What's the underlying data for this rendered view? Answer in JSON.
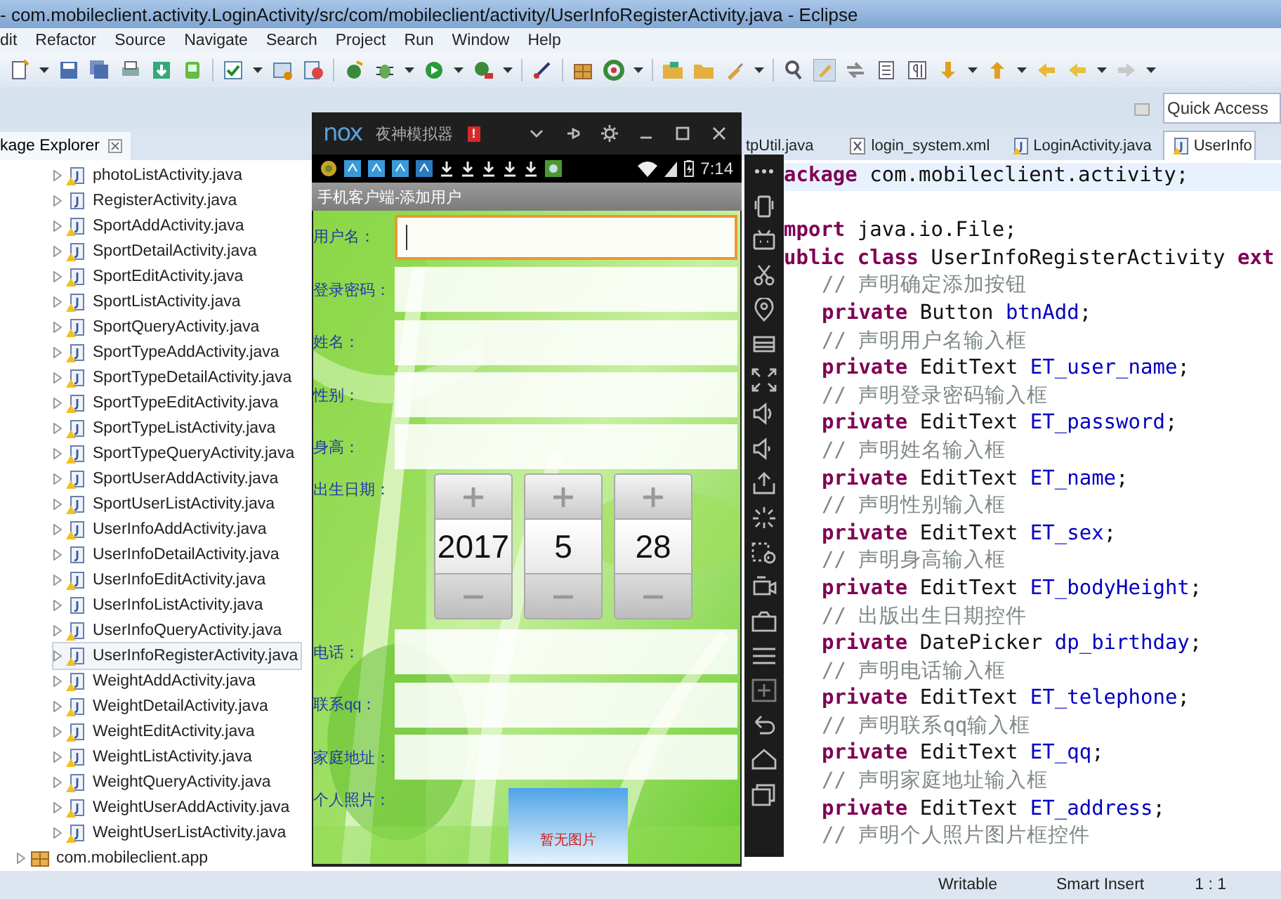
{
  "window": {
    "title": "- com.mobileclient.activity.LoginActivity/src/com/mobileclient/activity/UserInfoRegisterActivity.java - Eclipse"
  },
  "menu": [
    "dit",
    "Refactor",
    "Source",
    "Navigate",
    "Search",
    "Project",
    "Run",
    "Window",
    "Help"
  ],
  "quick_access": {
    "placeholder": "Quick Access"
  },
  "explorer": {
    "title": "kage Explorer",
    "items": [
      {
        "label": "photoListActivity.java",
        "kind": "file",
        "warning": true,
        "selected": false
      },
      {
        "label": "RegisterActivity.java",
        "kind": "file",
        "warning": false,
        "selected": false
      },
      {
        "label": "SportAddActivity.java",
        "kind": "file",
        "warning": true,
        "selected": false
      },
      {
        "label": "SportDetailActivity.java",
        "kind": "file",
        "warning": true,
        "selected": false
      },
      {
        "label": "SportEditActivity.java",
        "kind": "file",
        "warning": true,
        "selected": false
      },
      {
        "label": "SportListActivity.java",
        "kind": "file",
        "warning": true,
        "selected": false
      },
      {
        "label": "SportQueryActivity.java",
        "kind": "file",
        "warning": true,
        "selected": false
      },
      {
        "label": "SportTypeAddActivity.java",
        "kind": "file",
        "warning": true,
        "selected": false
      },
      {
        "label": "SportTypeDetailActivity.java",
        "kind": "file",
        "warning": true,
        "selected": false
      },
      {
        "label": "SportTypeEditActivity.java",
        "kind": "file",
        "warning": true,
        "selected": false
      },
      {
        "label": "SportTypeListActivity.java",
        "kind": "file",
        "warning": true,
        "selected": false
      },
      {
        "label": "SportTypeQueryActivity.java",
        "kind": "file",
        "warning": true,
        "selected": false
      },
      {
        "label": "SportUserAddActivity.java",
        "kind": "file",
        "warning": true,
        "selected": false
      },
      {
        "label": "SportUserListActivity.java",
        "kind": "file",
        "warning": true,
        "selected": false
      },
      {
        "label": "UserInfoAddActivity.java",
        "kind": "file",
        "warning": true,
        "selected": false
      },
      {
        "label": "UserInfoDetailActivity.java",
        "kind": "file",
        "warning": false,
        "selected": false
      },
      {
        "label": "UserInfoEditActivity.java",
        "kind": "file",
        "warning": true,
        "selected": false
      },
      {
        "label": "UserInfoListActivity.java",
        "kind": "file",
        "warning": false,
        "selected": false
      },
      {
        "label": "UserInfoQueryActivity.java",
        "kind": "file",
        "warning": true,
        "selected": false
      },
      {
        "label": "UserInfoRegisterActivity.java",
        "kind": "file",
        "warning": true,
        "selected": true
      },
      {
        "label": "WeightAddActivity.java",
        "kind": "file",
        "warning": true,
        "selected": false
      },
      {
        "label": "WeightDetailActivity.java",
        "kind": "file",
        "warning": true,
        "selected": false
      },
      {
        "label": "WeightEditActivity.java",
        "kind": "file",
        "warning": true,
        "selected": false
      },
      {
        "label": "WeightListActivity.java",
        "kind": "file",
        "warning": true,
        "selected": false
      },
      {
        "label": "WeightQueryActivity.java",
        "kind": "file",
        "warning": true,
        "selected": false
      },
      {
        "label": "WeightUserAddActivity.java",
        "kind": "file",
        "warning": true,
        "selected": false
      },
      {
        "label": "WeightUserListActivity.java",
        "kind": "file",
        "warning": true,
        "selected": false
      },
      {
        "label": "com.mobileclient.app",
        "kind": "package",
        "warning": false,
        "selected": false
      }
    ]
  },
  "editor": {
    "tabs": [
      {
        "label": "tpUtil.java",
        "selected": false
      },
      {
        "label": "login_system.xml",
        "kind": "xml",
        "selected": false
      },
      {
        "label": "LoginActivity.java",
        "kind": "java",
        "selected": false
      },
      {
        "label": "UserInfo",
        "kind": "java",
        "selected": true
      }
    ],
    "lines": [
      {
        "kind": "top",
        "current": true,
        "tokens": [
          {
            "kind": "keyword",
            "text": "ackage"
          },
          {
            "kind": "plain",
            "text": " com.mobileclient.activity;"
          }
        ]
      },
      {
        "kind": "blank"
      },
      {
        "kind": "top",
        "current": false,
        "tokens": [
          {
            "kind": "keyword",
            "text": "mport"
          },
          {
            "kind": "plain",
            "text": " java.io.File;"
          }
        ]
      },
      {
        "kind": "top",
        "current": false,
        "tokens": [
          {
            "kind": "keyword",
            "text": "ublic class"
          },
          {
            "kind": "plain",
            "text": " UserInfoRegisterActivity "
          },
          {
            "kind": "keyword",
            "text": "ext"
          }
        ]
      },
      {
        "kind": "member",
        "current": false,
        "tokens": [
          {
            "kind": "comment",
            "text": "// 声明确定添加按钮"
          }
        ]
      },
      {
        "kind": "member",
        "current": false,
        "tokens": [
          {
            "kind": "keyword",
            "text": "private"
          },
          {
            "kind": "plain",
            "text": " Button "
          },
          {
            "kind": "field",
            "text": "btnAdd"
          },
          {
            "kind": "plain",
            "text": ";"
          }
        ]
      },
      {
        "kind": "member",
        "current": false,
        "tokens": [
          {
            "kind": "comment",
            "text": "// 声明用户名输入框"
          }
        ]
      },
      {
        "kind": "member",
        "current": false,
        "tokens": [
          {
            "kind": "keyword",
            "text": "private"
          },
          {
            "kind": "plain",
            "text": " EditText "
          },
          {
            "kind": "field",
            "text": "ET_user_name"
          },
          {
            "kind": "plain",
            "text": ";"
          }
        ]
      },
      {
        "kind": "member",
        "current": false,
        "tokens": [
          {
            "kind": "comment",
            "text": "// 声明登录密码输入框"
          }
        ]
      },
      {
        "kind": "member",
        "current": false,
        "tokens": [
          {
            "kind": "keyword",
            "text": "private"
          },
          {
            "kind": "plain",
            "text": " EditText "
          },
          {
            "kind": "field",
            "text": "ET_password"
          },
          {
            "kind": "plain",
            "text": ";"
          }
        ]
      },
      {
        "kind": "member",
        "current": false,
        "tokens": [
          {
            "kind": "comment",
            "text": "// 声明姓名输入框"
          }
        ]
      },
      {
        "kind": "member",
        "current": false,
        "tokens": [
          {
            "kind": "keyword",
            "text": "private"
          },
          {
            "kind": "plain",
            "text": " EditText "
          },
          {
            "kind": "field",
            "text": "ET_name"
          },
          {
            "kind": "plain",
            "text": ";"
          }
        ]
      },
      {
        "kind": "member",
        "current": false,
        "tokens": [
          {
            "kind": "comment",
            "text": "// 声明性别输入框"
          }
        ]
      },
      {
        "kind": "member",
        "current": false,
        "tokens": [
          {
            "kind": "keyword",
            "text": "private"
          },
          {
            "kind": "plain",
            "text": " EditText "
          },
          {
            "kind": "field",
            "text": "ET_sex"
          },
          {
            "kind": "plain",
            "text": ";"
          }
        ]
      },
      {
        "kind": "member",
        "current": false,
        "tokens": [
          {
            "kind": "comment",
            "text": "// 声明身高输入框"
          }
        ]
      },
      {
        "kind": "member",
        "current": false,
        "tokens": [
          {
            "kind": "keyword",
            "text": "private"
          },
          {
            "kind": "plain",
            "text": " EditText "
          },
          {
            "kind": "field",
            "text": "ET_bodyHeight"
          },
          {
            "kind": "plain",
            "text": ";"
          }
        ]
      },
      {
        "kind": "member",
        "current": false,
        "tokens": [
          {
            "kind": "comment",
            "text": "// 出版出生日期控件"
          }
        ]
      },
      {
        "kind": "member",
        "current": false,
        "tokens": [
          {
            "kind": "keyword",
            "text": "private"
          },
          {
            "kind": "plain",
            "text": " DatePicker "
          },
          {
            "kind": "field",
            "text": "dp_birthday"
          },
          {
            "kind": "plain",
            "text": ";"
          }
        ]
      },
      {
        "kind": "member",
        "current": false,
        "tokens": [
          {
            "kind": "comment",
            "text": "// 声明电话输入框"
          }
        ]
      },
      {
        "kind": "member",
        "current": false,
        "tokens": [
          {
            "kind": "keyword",
            "text": "private"
          },
          {
            "kind": "plain",
            "text": " EditText "
          },
          {
            "kind": "field",
            "text": "ET_telephone"
          },
          {
            "kind": "plain",
            "text": ";"
          }
        ]
      },
      {
        "kind": "member",
        "current": false,
        "tokens": [
          {
            "kind": "comment",
            "text": "// 声明联系qq输入框"
          }
        ]
      },
      {
        "kind": "member",
        "current": false,
        "tokens": [
          {
            "kind": "keyword",
            "text": "private"
          },
          {
            "kind": "plain",
            "text": " EditText "
          },
          {
            "kind": "field",
            "text": "ET_qq"
          },
          {
            "kind": "plain",
            "text": ";"
          }
        ]
      },
      {
        "kind": "member",
        "current": false,
        "tokens": [
          {
            "kind": "comment",
            "text": "// 声明家庭地址输入框"
          }
        ]
      },
      {
        "kind": "member",
        "current": false,
        "tokens": [
          {
            "kind": "keyword",
            "text": "private"
          },
          {
            "kind": "plain",
            "text": " EditText "
          },
          {
            "kind": "field",
            "text": "ET_address"
          },
          {
            "kind": "plain",
            "text": ";"
          }
        ]
      },
      {
        "kind": "member",
        "current": false,
        "tokens": [
          {
            "kind": "comment",
            "text": "// 声明个人照片图片框控件"
          }
        ]
      }
    ]
  },
  "status_bar": [
    "Writable",
    "Smart Insert",
    "1 : 1"
  ],
  "emulator": {
    "logo": "nox",
    "title": "夜神模拟器",
    "alert_badge": "!",
    "clock": "7:14",
    "app_title": "手机客户端-添加用户",
    "fields": [
      {
        "label": "用户名：",
        "kind": "text",
        "focused": true
      },
      {
        "label": "登录密码：",
        "kind": "text",
        "focused": false
      },
      {
        "label": "姓名：",
        "kind": "text",
        "focused": false
      },
      {
        "label": "性别：",
        "kind": "text",
        "focused": false
      },
      {
        "label": "身高：",
        "kind": "text",
        "focused": false
      },
      {
        "label": "出生日期：",
        "kind": "date",
        "values": [
          "2017",
          "5",
          "28"
        ]
      },
      {
        "label": "电话：",
        "kind": "text",
        "focused": false
      },
      {
        "label": "联系qq：",
        "kind": "text",
        "focused": false
      },
      {
        "label": "家庭地址：",
        "kind": "text",
        "focused": false
      },
      {
        "label": "个人照片：",
        "photo_text": "暂无图片"
      }
    ]
  }
}
